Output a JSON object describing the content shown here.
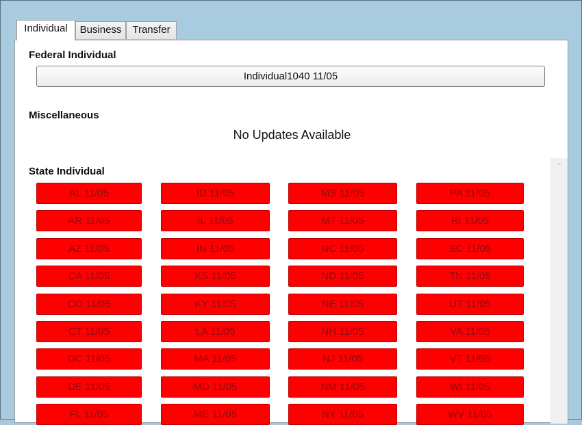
{
  "tabs": [
    {
      "label": "Individual",
      "active": true
    },
    {
      "label": "Business",
      "active": false
    },
    {
      "label": "Transfer",
      "active": false
    }
  ],
  "federal": {
    "title": "Federal Individual",
    "button_label": "Individual1040 11/05"
  },
  "misc": {
    "title": "Miscellaneous",
    "message": "No Updates Available"
  },
  "state": {
    "title": "State Individual",
    "button_color": "#ff0000",
    "columns": [
      [
        "AL 11/05",
        "AR 11/05",
        "AZ 11/05",
        "CA 11/05",
        "CO 11/05",
        "CT 11/05",
        "DC 11/05",
        "DE 11/05",
        "FL 11/05"
      ],
      [
        "ID 11/05",
        "IL 11/05",
        "IN 11/05",
        "KS 11/05",
        "KY 11/05",
        "LA 11/05",
        "MA 11/05",
        "MD 11/05",
        "ME 11/05"
      ],
      [
        "MS 11/05",
        "MT 11/05",
        "NC 11/05",
        "ND 11/05",
        "NE 11/05",
        "NH 11/05",
        "NJ 11/05",
        "NM 11/05",
        "NY 11/05"
      ],
      [
        "PA 11/05",
        "RI 11/05",
        "SC 11/05",
        "TN 11/05",
        "UT 11/05",
        "VA 11/05",
        "VT 11/05",
        "WI 11/05",
        "WV 11/05"
      ]
    ]
  },
  "icons": {
    "scroll_up": "chevron-up-icon"
  }
}
